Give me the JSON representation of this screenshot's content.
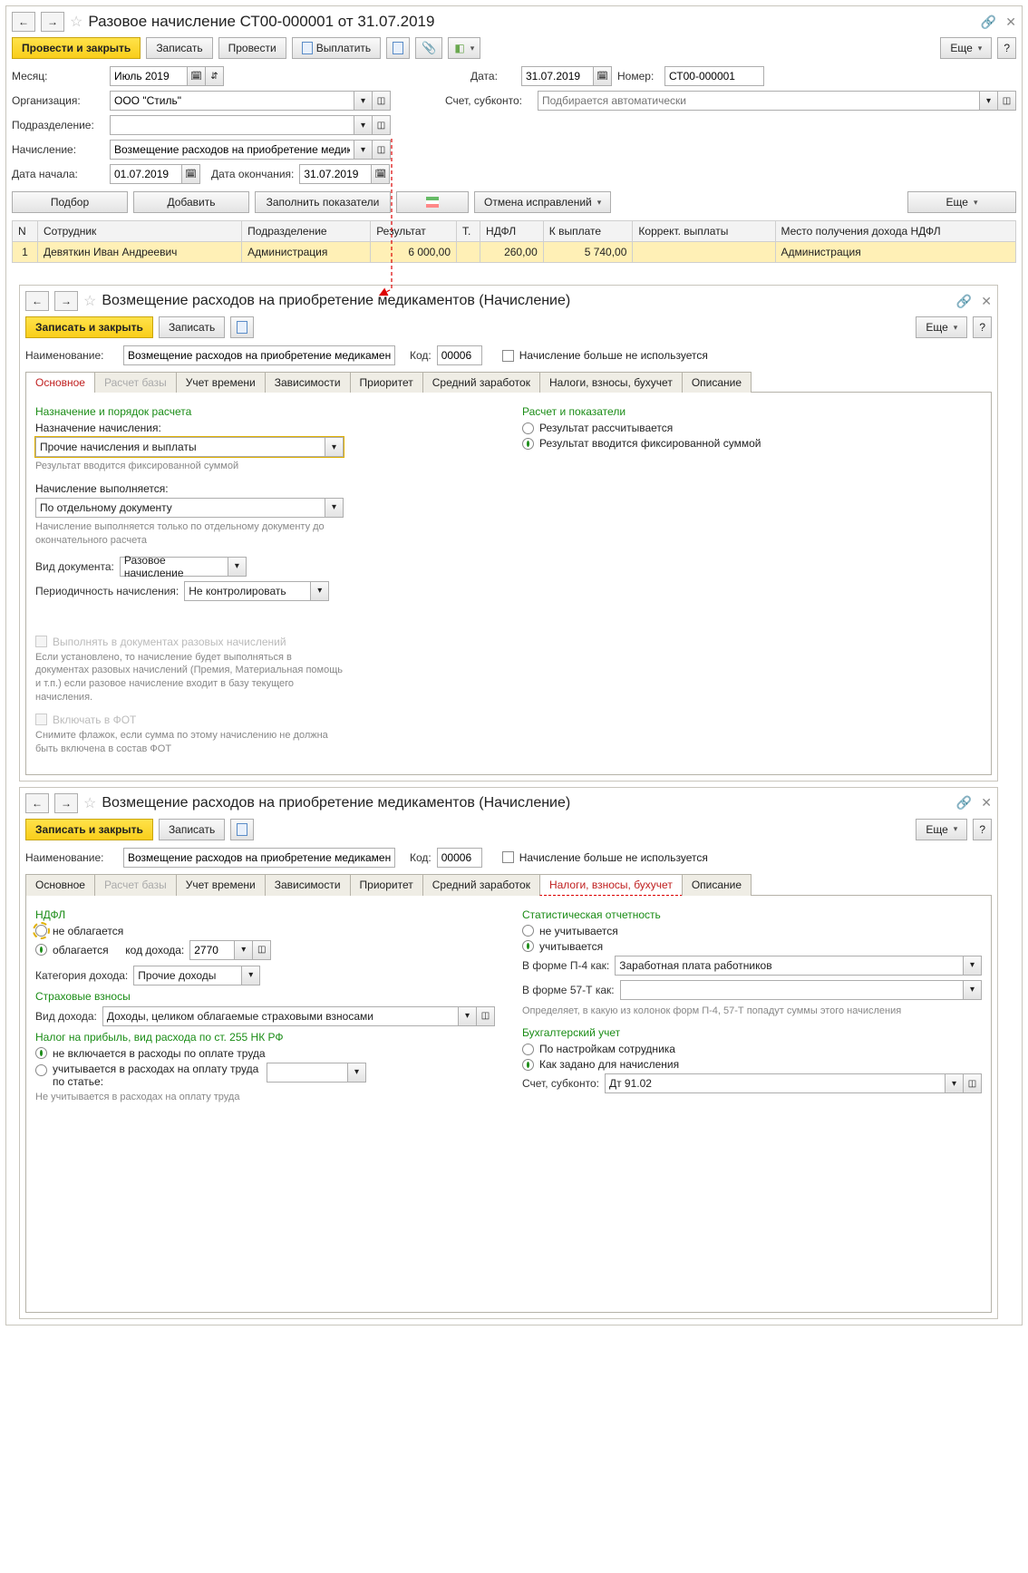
{
  "win1": {
    "title": "Разовое начисление СТ00-000001 от 31.07.2019",
    "toolbar": {
      "post_close": "Провести и закрыть",
      "write": "Записать",
      "post": "Провести",
      "pay": "Выплатить",
      "more": "Еще"
    },
    "fields": {
      "month_lbl": "Месяц:",
      "month": "Июль 2019",
      "date_lbl": "Дата:",
      "date": "31.07.2019",
      "number_lbl": "Номер:",
      "number": "СТ00-000001",
      "org_lbl": "Организация:",
      "org": "ООО \"Стиль\"",
      "account_lbl": "Счет, субконто:",
      "account_ph": "Подбирается автоматически",
      "dept_lbl": "Подразделение:",
      "accrual_lbl": "Начисление:",
      "accrual": "Возмещение расходов на приобретение медикаментов",
      "start_lbl": "Дата начала:",
      "start": "01.07.2019",
      "end_lbl": "Дата окончания:",
      "end": "31.07.2019"
    },
    "wtb": {
      "select": "Подбор",
      "add": "Добавить",
      "fill": "Заполнить показатели",
      "cancel": "Отмена исправлений",
      "more": "Еще"
    },
    "table": {
      "h": [
        "N",
        "Сотрудник",
        "Подразделение",
        "Результат",
        "Т.",
        "НДФЛ",
        "К выплате",
        "Коррект. выплаты",
        "Место получения дохода НДФЛ"
      ],
      "row": {
        "n": "1",
        "emp": "Девяткин Иван Андреевич",
        "dept": "Администрация",
        "res": "6 000,00",
        "ndfl": "260,00",
        "pay": "5 740,00",
        "place": "Администрация"
      }
    }
  },
  "win2": {
    "title": "Возмещение расходов на приобретение медикаментов (Начисление)",
    "toolbar": {
      "save_close": "Записать и закрыть",
      "write": "Записать",
      "more": "Еще"
    },
    "name_lbl": "Наименование:",
    "name": "Возмещение расходов на приобретение медикаментов",
    "code_lbl": "Код:",
    "code": "00006",
    "not_used": "Начисление больше не используется",
    "tabs": [
      "Основное",
      "Расчет базы",
      "Учет времени",
      "Зависимости",
      "Приоритет",
      "Средний заработок",
      "Налоги, взносы, бухучет",
      "Описание"
    ],
    "tab1": {
      "purpose_title": "Назначение и порядок расчета",
      "purpose_lbl": "Назначение начисления:",
      "purpose": "Прочие начисления и выплаты",
      "purpose_hint": "Результат вводится фиксированной суммой",
      "calc_title": "Расчет и показатели",
      "r_calc": "Результат рассчитывается",
      "r_fixed": "Результат вводится фиксированной суммой",
      "exec_lbl": "Начисление выполняется:",
      "exec": "По отдельному документу",
      "exec_hint": "Начисление выполняется только по отдельному документу до окончательного расчета",
      "doctype_lbl": "Вид документа:",
      "doctype": "Разовое начисление",
      "period_lbl": "Периодичность начисления:",
      "period": "Не контролировать",
      "chk1": "Выполнять в документах разовых начислений",
      "chk1_hint": "Если установлено, то начисление будет выполняться в документах разовых начислений (Премия, Материальная помощь и т.п.) если разовое начисление входит в базу текущего начисления.",
      "chk2": "Включать в ФОТ",
      "chk2_hint": "Снимите флажок, если сумма по этому начислению не должна быть включена в состав ФОТ"
    }
  },
  "win3": {
    "tab": {
      "ndfl_title": "НДФЛ",
      "r_notax": "не облагается",
      "r_tax": "облагается",
      "code_lbl": "код дохода:",
      "code": "2770",
      "cat_lbl": "Категория дохода:",
      "cat": "Прочие доходы",
      "ins_title": "Страховые взносы",
      "inc_lbl": "Вид дохода:",
      "inc": "Доходы, целиком облагаемые страховыми взносами",
      "profit_title": "Налог на прибыль, вид расхода по ст. 255 НК РФ",
      "r_noexp": "не включается в расходы по оплате труда",
      "r_exp": "учитывается в расходах на оплату труда по статье:",
      "profit_hint": "Не учитывается в расходах на оплату труда",
      "stat_title": "Статистическая отчетность",
      "r_nostat": "не учитывается",
      "r_stat": "учитывается",
      "p4_lbl": "В форме П-4 как:",
      "p4": "Заработная плата работников",
      "p57_lbl": "В форме 57-Т как:",
      "stat_hint": "Определяет, в какую из колонок форм П-4, 57-Т попадут суммы этого начисления",
      "acc_title": "Бухгалтерский учет",
      "r_emp": "По настройкам сотрудника",
      "r_accr": "Как задано для начисления",
      "account_lbl": "Счет, субконто:",
      "account": "Дт 91.02"
    }
  }
}
